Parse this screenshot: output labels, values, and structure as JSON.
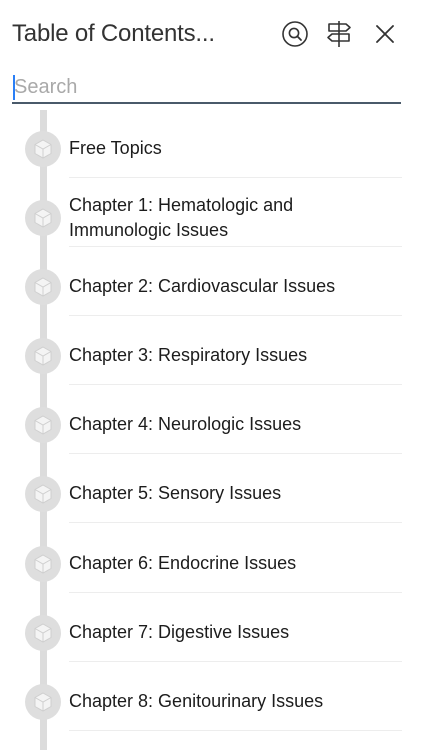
{
  "header": {
    "title": "Table of Contents...",
    "search_button_icon": "search-circle-icon",
    "navigate_button_icon": "signpost-icon",
    "close_button_icon": "close-icon"
  },
  "search": {
    "placeholder": "Search",
    "value": ""
  },
  "toc": {
    "item_icon": "cube-icon",
    "items": [
      {
        "label": "Free Topics"
      },
      {
        "label": "Chapter 1: Hematologic and Immunologic Issues"
      },
      {
        "label": "Chapter 2: Cardiovascular Issues"
      },
      {
        "label": "Chapter 3: Respiratory Issues"
      },
      {
        "label": "Chapter 4: Neurologic Issues"
      },
      {
        "label": "Chapter 5: Sensory Issues"
      },
      {
        "label": "Chapter 6: Endocrine Issues"
      },
      {
        "label": "Chapter 7: Digestive Issues"
      },
      {
        "label": "Chapter 8: Genitourinary Issues"
      }
    ]
  },
  "colors": {
    "search_underline": "#4a5a6a",
    "caret": "#2a7ff6",
    "timeline": "#dcdcdc",
    "node": "#dedede"
  }
}
